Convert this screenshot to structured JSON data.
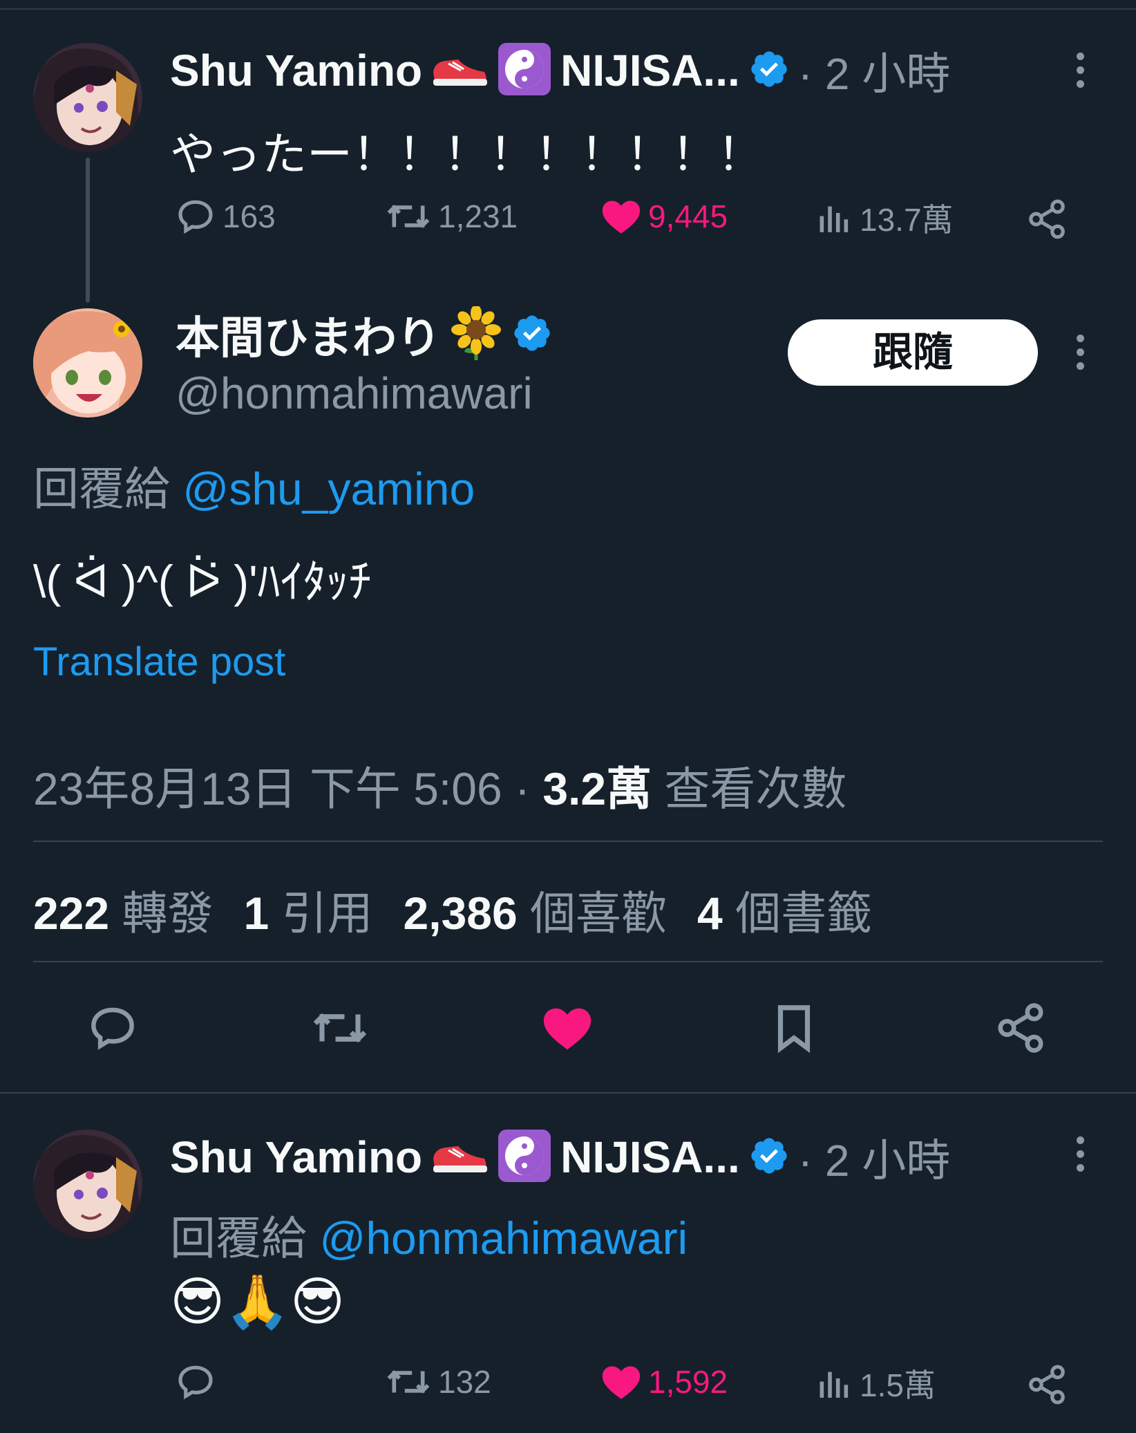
{
  "tweet1": {
    "display_name": "Shu Yamino",
    "name_suffix": "NIJISA...",
    "time": "· 2 小時",
    "text": "やったー！！！！！！！！！",
    "actions": {
      "reply_count": "163",
      "retweet_count": "1,231",
      "like_count": "9,445",
      "views_count": "13.7萬"
    }
  },
  "main_tweet": {
    "display_name": "本間ひまわり",
    "handle": "@honmahimawari",
    "follow_label": "跟隨",
    "reply_prefix": "回覆給 ",
    "reply_handle": "@shu_yamino",
    "text": "\\( ᐛ )^( ᐖ )ʹﾊｲﾀｯﾁ",
    "translate_label": "Translate post",
    "datetime": "23年8月13日 下午 5:06",
    "dot": " · ",
    "views_value": "3.2萬",
    "views_label": " 查看次數",
    "stats": {
      "retweets_value": "222",
      "retweets_label": " 轉發",
      "quotes_value": "1",
      "quotes_label": " 引用",
      "likes_value": "2,386",
      "likes_label": " 個喜歡",
      "bookmarks_value": "4",
      "bookmarks_label": " 個書籤"
    }
  },
  "tweet3": {
    "display_name": "Shu Yamino",
    "name_suffix": "NIJISA...",
    "time": "· 2 小時",
    "reply_prefix": "回覆給 ",
    "reply_handle": "@honmahimawari",
    "text": "😎🙏😎",
    "actions": {
      "reply_count": "",
      "retweet_count": "132",
      "like_count": "1,592",
      "views_count": "1.5萬"
    }
  },
  "colors": {
    "background": "#15202b",
    "like_pink": "#f91880",
    "link_blue": "#1d9bf0",
    "muted": "#8b98a5"
  },
  "icons": [
    "reply-icon",
    "retweet-icon",
    "heart-icon",
    "views-icon",
    "share-icon",
    "bookmark-icon",
    "verified-badge-icon",
    "kebab-icon",
    "sneaker-emoji",
    "yin-yang-emoji",
    "sunflower-emoji"
  ]
}
